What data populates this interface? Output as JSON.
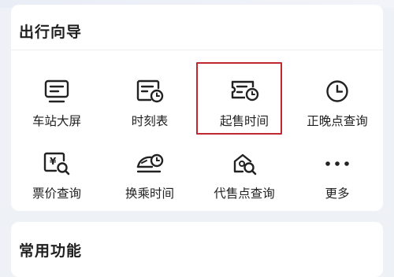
{
  "guide": {
    "title": "出行向导",
    "items": [
      {
        "label": "车站大屏",
        "icon": "station-screen-icon"
      },
      {
        "label": "时刻表",
        "icon": "timetable-icon"
      },
      {
        "label": "起售时间",
        "icon": "ticket-sale-time-icon"
      },
      {
        "label": "正晚点查询",
        "icon": "clock-icon"
      },
      {
        "label": "票价查询",
        "icon": "fare-search-icon"
      },
      {
        "label": "换乘时间",
        "icon": "transfer-train-icon"
      },
      {
        "label": "代售点查询",
        "icon": "agency-search-icon"
      },
      {
        "label": "更多",
        "icon": "more-dots-icon"
      }
    ],
    "highlighted_item": "起售时间",
    "highlight_color": "#c0282f"
  },
  "common": {
    "title": "常用功能"
  }
}
